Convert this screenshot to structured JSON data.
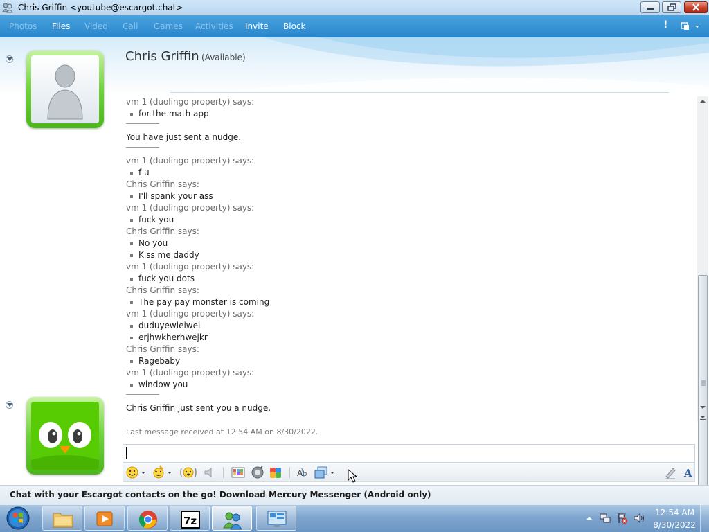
{
  "window": {
    "title": "Chris Griffin <youtube@escargot.chat>"
  },
  "menu": {
    "items": [
      {
        "label": "Photos",
        "enabled": false
      },
      {
        "label": "Files",
        "enabled": true
      },
      {
        "label": "Video",
        "enabled": false
      },
      {
        "label": "Call",
        "enabled": false
      },
      {
        "label": "Games",
        "enabled": false
      },
      {
        "label": "Activities",
        "enabled": false
      },
      {
        "label": "Invite",
        "enabled": true
      },
      {
        "label": "Block",
        "enabled": true
      }
    ],
    "alert_glyph": "!"
  },
  "contact": {
    "name": "Chris Griffin",
    "status": "(Available)"
  },
  "conversation": {
    "lines": [
      {
        "kind": "says",
        "text": "vm 1 (duolingo property) says:"
      },
      {
        "kind": "msg",
        "text": "for the math app"
      },
      {
        "kind": "sep"
      },
      {
        "kind": "system",
        "text": "You have just sent a nudge."
      },
      {
        "kind": "sep"
      },
      {
        "kind": "says",
        "text": "vm 1 (duolingo property) says:"
      },
      {
        "kind": "msg",
        "text": "f u"
      },
      {
        "kind": "says",
        "text": "Chris Griffin says:"
      },
      {
        "kind": "msg",
        "text": "I'll spank your ass"
      },
      {
        "kind": "says",
        "text": "vm 1 (duolingo property) says:"
      },
      {
        "kind": "msg",
        "text": "fuck you"
      },
      {
        "kind": "says",
        "text": "Chris Griffin says:"
      },
      {
        "kind": "msg",
        "text": "No you"
      },
      {
        "kind": "msg",
        "text": "Kiss me daddy"
      },
      {
        "kind": "says",
        "text": "vm 1 (duolingo property) says:"
      },
      {
        "kind": "msg",
        "text": "fuck you dots"
      },
      {
        "kind": "says",
        "text": "Chris Griffin says:"
      },
      {
        "kind": "msg",
        "text": "The pay pay monster is coming"
      },
      {
        "kind": "says",
        "text": "vm 1 (duolingo property) says:"
      },
      {
        "kind": "msg",
        "text": "duduyewieiwei"
      },
      {
        "kind": "msg",
        "text": "erjhwkherhwejkr"
      },
      {
        "kind": "says",
        "text": "Chris Griffin says:"
      },
      {
        "kind": "msg",
        "text": "Ragebaby"
      },
      {
        "kind": "says",
        "text": "vm 1 (duolingo property) says:"
      },
      {
        "kind": "msg",
        "text": "window you"
      },
      {
        "kind": "sep"
      },
      {
        "kind": "system",
        "text": "Chris Griffin just sent you a nudge."
      },
      {
        "kind": "sep"
      },
      {
        "kind": "last",
        "text": "Last message received at 12:54 AM on 8/30/2022."
      }
    ]
  },
  "compose": {
    "value": "",
    "toolbar": [
      "emoticon-icon",
      "wink-icon",
      "nudge-icon",
      "voice-clip-icon",
      "background-icon",
      "sound-icon",
      "games-icon",
      "text-style-icon",
      "share-icon",
      "handwriting-icon",
      "font-icon"
    ]
  },
  "ad": {
    "text": "Chat with your Escargot contacts on the go! Download Mercury Messenger (Android only)"
  },
  "taskbar": {
    "pinned": [
      "explorer-icon",
      "media-player-icon",
      "chrome-icon",
      "7zip-icon",
      "messenger-icon",
      "remote-desktop-icon"
    ],
    "active": "messenger-icon",
    "clock_time": "12:54 AM",
    "clock_date": "8/30/2022"
  },
  "colors": {
    "menu_bar": "#2a86cc",
    "avatar_frame": "#6fd33c",
    "duolingo_green": "#58cc02"
  }
}
